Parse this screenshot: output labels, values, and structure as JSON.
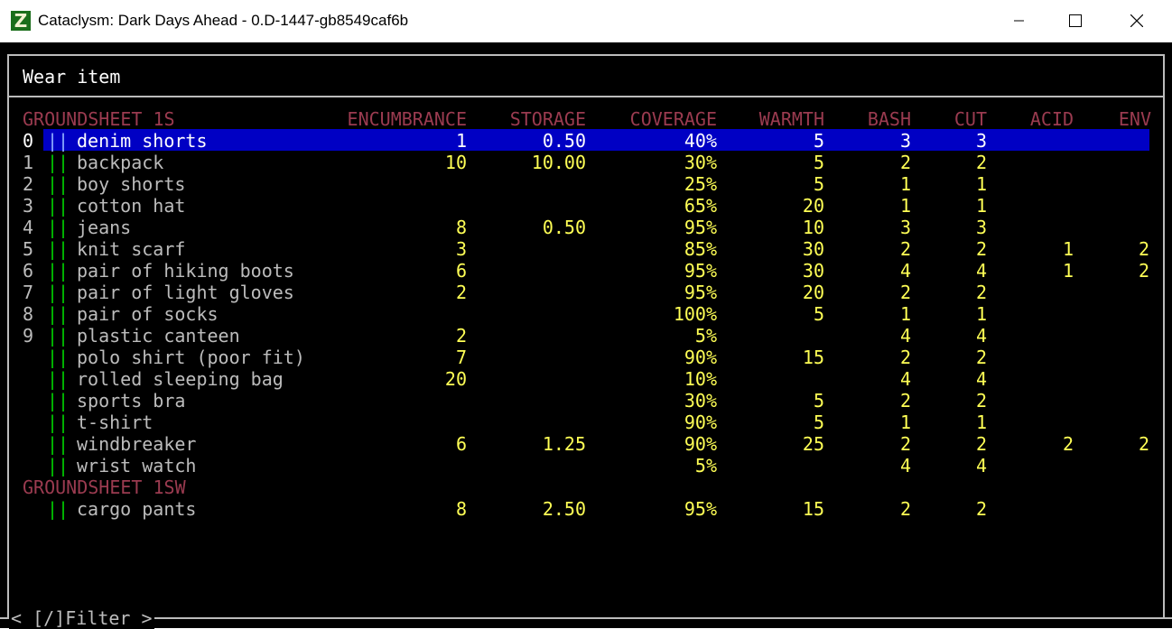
{
  "window": {
    "title": "Cataclysm: Dark Days Ahead - 0.D-1447-gb8549caf6b",
    "icon_letter": "Z",
    "minimize_glyph": "—",
    "maximize_glyph": "☐",
    "close_glyph": "✕"
  },
  "menu": {
    "title": "Wear item",
    "filter": "< [/]Filter >"
  },
  "columns": [
    "ENCUMBRANCE",
    "STORAGE",
    "COVERAGE",
    "WARMTH",
    "BASH",
    "CUT",
    "ACID",
    "ENV"
  ],
  "groups": [
    {
      "label": "GROUNDSHEET 1S",
      "items": [
        {
          "key": "0",
          "name": "denim shorts",
          "enc": "1",
          "storage": "0.50",
          "coverage": "40%",
          "warmth": "5",
          "bash": "3",
          "cut": "3",
          "acid": "",
          "env": "",
          "selected": true
        },
        {
          "key": "1",
          "name": "backpack",
          "enc": "10",
          "storage": "10.00",
          "coverage": "30%",
          "warmth": "5",
          "bash": "2",
          "cut": "2",
          "acid": "",
          "env": ""
        },
        {
          "key": "2",
          "name": "boy shorts",
          "enc": "",
          "storage": "",
          "coverage": "25%",
          "warmth": "5",
          "bash": "1",
          "cut": "1",
          "acid": "",
          "env": ""
        },
        {
          "key": "3",
          "name": "cotton hat",
          "enc": "",
          "storage": "",
          "coverage": "65%",
          "warmth": "20",
          "bash": "1",
          "cut": "1",
          "acid": "",
          "env": ""
        },
        {
          "key": "4",
          "name": "jeans",
          "enc": "8",
          "storage": "0.50",
          "coverage": "95%",
          "warmth": "10",
          "bash": "3",
          "cut": "3",
          "acid": "",
          "env": ""
        },
        {
          "key": "5",
          "name": "knit scarf",
          "enc": "3",
          "storage": "",
          "coverage": "85%",
          "warmth": "30",
          "bash": "2",
          "cut": "2",
          "acid": "1",
          "env": "2"
        },
        {
          "key": "6",
          "name": "pair of hiking boots",
          "enc": "6",
          "storage": "",
          "coverage": "95%",
          "warmth": "30",
          "bash": "4",
          "cut": "4",
          "acid": "1",
          "env": "2"
        },
        {
          "key": "7",
          "name": "pair of light gloves",
          "enc": "2",
          "storage": "",
          "coverage": "95%",
          "warmth": "20",
          "bash": "2",
          "cut": "2",
          "acid": "",
          "env": ""
        },
        {
          "key": "8",
          "name": "pair of socks",
          "enc": "",
          "storage": "",
          "coverage": "100%",
          "warmth": "5",
          "bash": "1",
          "cut": "1",
          "acid": "",
          "env": ""
        },
        {
          "key": "9",
          "name": "plastic canteen",
          "enc": "2",
          "storage": "",
          "coverage": "5%",
          "warmth": "",
          "bash": "4",
          "cut": "4",
          "acid": "",
          "env": ""
        },
        {
          "key": "",
          "name": "polo shirt (poor fit)",
          "enc": "7",
          "storage": "",
          "coverage": "90%",
          "warmth": "15",
          "bash": "2",
          "cut": "2",
          "acid": "",
          "env": ""
        },
        {
          "key": "",
          "name": "rolled sleeping bag",
          "enc": "20",
          "storage": "",
          "coverage": "10%",
          "warmth": "",
          "bash": "4",
          "cut": "4",
          "acid": "",
          "env": ""
        },
        {
          "key": "",
          "name": "sports bra",
          "enc": "",
          "storage": "",
          "coverage": "30%",
          "warmth": "5",
          "bash": "2",
          "cut": "2",
          "acid": "",
          "env": ""
        },
        {
          "key": "",
          "name": "t-shirt",
          "enc": "",
          "storage": "",
          "coverage": "90%",
          "warmth": "5",
          "bash": "1",
          "cut": "1",
          "acid": "",
          "env": ""
        },
        {
          "key": "",
          "name": "windbreaker",
          "enc": "6",
          "storage": "1.25",
          "coverage": "90%",
          "warmth": "25",
          "bash": "2",
          "cut": "2",
          "acid": "2",
          "env": "2"
        },
        {
          "key": "",
          "name": "wrist watch",
          "enc": "",
          "storage": "",
          "coverage": "5%",
          "warmth": "",
          "bash": "4",
          "cut": "4",
          "acid": "",
          "env": ""
        }
      ]
    },
    {
      "label": "GROUNDSHEET 1SW",
      "items": [
        {
          "key": "",
          "name": "cargo pants",
          "enc": "8",
          "storage": "2.50",
          "coverage": "95%",
          "warmth": "15",
          "bash": "2",
          "cut": "2",
          "acid": "",
          "env": ""
        }
      ]
    }
  ],
  "colors": {
    "background": "#000000",
    "selection": "#0000c4",
    "value": "#ffff55",
    "marker": "#00cc00",
    "item_text": "#bcbcbc",
    "header": "#9b3b50"
  },
  "marker_glyph": "||"
}
